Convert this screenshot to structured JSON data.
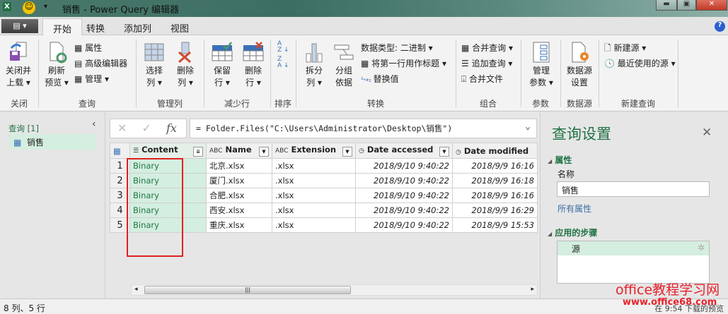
{
  "window": {
    "title": "销售 - Power Query 编辑器",
    "minimize": "▬",
    "restore": "▣",
    "close": "✕",
    "help": "?"
  },
  "tabs": [
    {
      "label": "开始",
      "active": true
    },
    {
      "label": "转换"
    },
    {
      "label": "添加列"
    },
    {
      "label": "视图"
    }
  ],
  "file_button": "▤ ▾",
  "ribbon": {
    "close_group": {
      "label": "关闭",
      "close_load": "关闭并\n上载 ▾"
    },
    "query_group": {
      "label": "查询",
      "refresh": "刷新\n预览 ▾",
      "properties": "属性",
      "advanced_editor": "高级编辑器",
      "manage": "管理 ▾"
    },
    "columns_group": {
      "label": "管理列",
      "choose": "选择\n列 ▾",
      "remove": "删除\n列 ▾"
    },
    "rows_group": {
      "label": "减少行",
      "keep": "保留\n行 ▾",
      "remove": "删除\n行 ▾"
    },
    "sort_group": {
      "label": "排序"
    },
    "transform_group": {
      "label": "转换",
      "split": "拆分\n列 ▾",
      "group_by": "分组\n依据",
      "data_type": "数据类型: 二进制 ▾",
      "first_row_header": "将第一行用作标题 ▾",
      "replace_values": "替换值"
    },
    "combine_group": {
      "label": "组合",
      "merge": "合并查询 ▾",
      "append": "追加查询 ▾",
      "combine_files": "合并文件"
    },
    "params_group": {
      "label": "参数",
      "manage": "管理\n参数 ▾"
    },
    "datasource_group": {
      "label": "数据源",
      "settings": "数据源\n设置"
    },
    "newquery_group": {
      "label": "新建查询",
      "new_source": "新建源 ▾",
      "recent": "最近使用的源 ▾"
    }
  },
  "left": {
    "header": "查询 [1]",
    "queries": [
      "销售"
    ]
  },
  "formula": "= Folder.Files(\"C:\\Users\\Administrator\\Desktop\\销售\")",
  "table": {
    "columns": [
      "Content",
      "Name",
      "Extension",
      "Date accessed",
      "Date modified"
    ],
    "rows": [
      [
        "1",
        "Binary",
        "北京.xlsx",
        ".xlsx",
        "2018/9/10 9:40:22",
        "2018/9/9 16:16"
      ],
      [
        "2",
        "Binary",
        "厦门.xlsx",
        ".xlsx",
        "2018/9/10 9:40:22",
        "2018/9/9 16:18"
      ],
      [
        "3",
        "Binary",
        "合肥.xlsx",
        ".xlsx",
        "2018/9/10 9:40:22",
        "2018/9/9 16:16"
      ],
      [
        "4",
        "Binary",
        "西安.xlsx",
        ".xlsx",
        "2018/9/10 9:40:22",
        "2018/9/9 16:29"
      ],
      [
        "5",
        "Binary",
        "重庆.xlsx",
        ".xlsx",
        "2018/9/10 9:40:22",
        "2018/9/9 15:53"
      ]
    ]
  },
  "settings": {
    "title": "查询设置",
    "properties": "属性",
    "name_label": "名称",
    "name_value": "销售",
    "all_properties": "所有属性",
    "steps_label": "应用的步骤",
    "steps": [
      "源"
    ]
  },
  "status": {
    "left": "8 列、5 行",
    "right": "在 9:54 下载的预览"
  },
  "watermark": {
    "line1": "office教程学习网",
    "line2": "www.office68.com"
  },
  "colors": {
    "accent": "#217346",
    "selected": "#d4eee0",
    "highlight_box": "#e02020"
  }
}
